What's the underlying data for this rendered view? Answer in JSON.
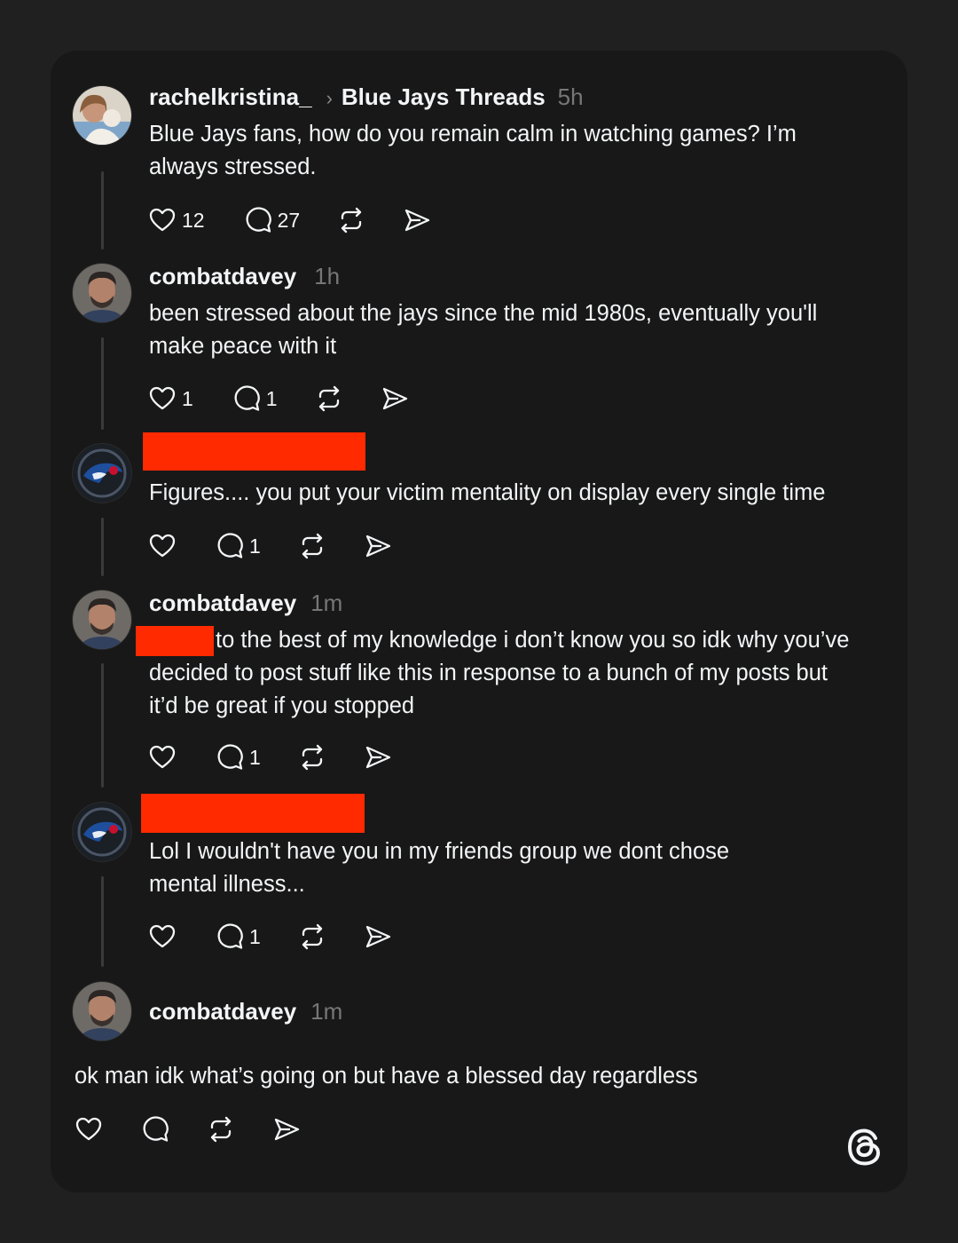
{
  "posts": [
    {
      "username": "rachelkristina_",
      "community": "Blue Jays Threads",
      "time": "5h",
      "text": "Blue Jays fans, how do you remain calm in watching games? I’m always stressed.",
      "likes": "12",
      "replies": "27"
    },
    {
      "username": "combatdavey",
      "time": "1h",
      "text": "been stressed about the jays since the mid 1980s, eventually you'll make peace with it",
      "likes": "1",
      "replies": "1"
    },
    {
      "username_redacted": true,
      "text": "Figures.... you put your victim mentality on display every single time",
      "likes": "",
      "replies": "1"
    },
    {
      "username": "combatdavey",
      "time": "1m",
      "text": "to the best of my knowledge i don’t know you so idk why you’ve decided to post stuff like this in response to a bunch of my posts but it’d be great if you stopped",
      "likes": "",
      "replies": "1"
    },
    {
      "username_redacted": true,
      "text": "Lol I wouldn't have you in my friends group we dont chose mental illness...",
      "likes": "",
      "replies": "1"
    },
    {
      "username": "combatdavey",
      "time": "1m",
      "text": "ok man idk what’s going on but have a blessed day regardless",
      "likes": "",
      "replies": ""
    }
  ],
  "icons": {
    "like": "heart-icon",
    "reply": "comment-icon",
    "repost": "repost-icon",
    "share": "send-icon",
    "brand": "threads-logo-icon"
  },
  "colors": {
    "background": "#202020",
    "card": "#181818",
    "text": "#f3f5f7",
    "muted": "#777777",
    "redaction": "#ff2a00"
  }
}
